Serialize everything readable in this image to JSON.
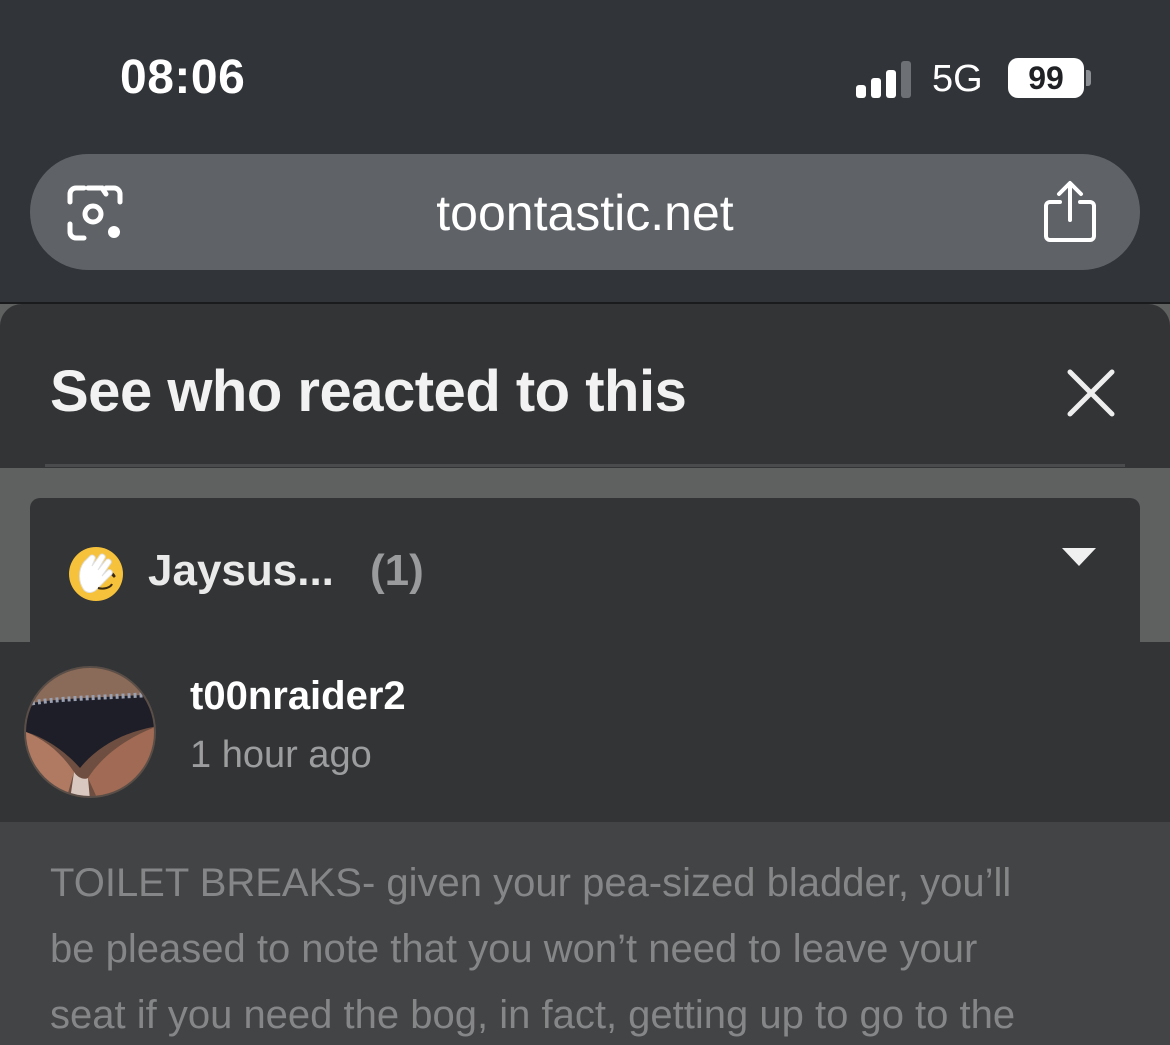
{
  "status_bar": {
    "time": "08:06",
    "network": "5G",
    "battery": "99"
  },
  "browser": {
    "url": "toontastic.net",
    "left_icon": "camera-search-icon",
    "right_icon": "share-icon"
  },
  "modal": {
    "title": "See who reacted to this",
    "close_icon": "close-icon",
    "reaction": {
      "emoji_icon": "facepalm-emoji-icon",
      "name": "Jaysus...",
      "count": "(1)"
    },
    "users": [
      {
        "username": "t00nraider2",
        "time": "1 hour ago"
      }
    ]
  },
  "background_post": {
    "lines": [
      "TOILET BREAKS- given your pea-sized bladder, you’ll",
      "be pleased to note that you won’t need to leave your",
      "seat if you need the bog, in fact, getting up to go to the"
    ]
  },
  "colors": {
    "status_bg": "#313438",
    "url_pill": "#5f6367",
    "modal_panel": "#333435",
    "emoji_yellow": "#f6c13b"
  }
}
